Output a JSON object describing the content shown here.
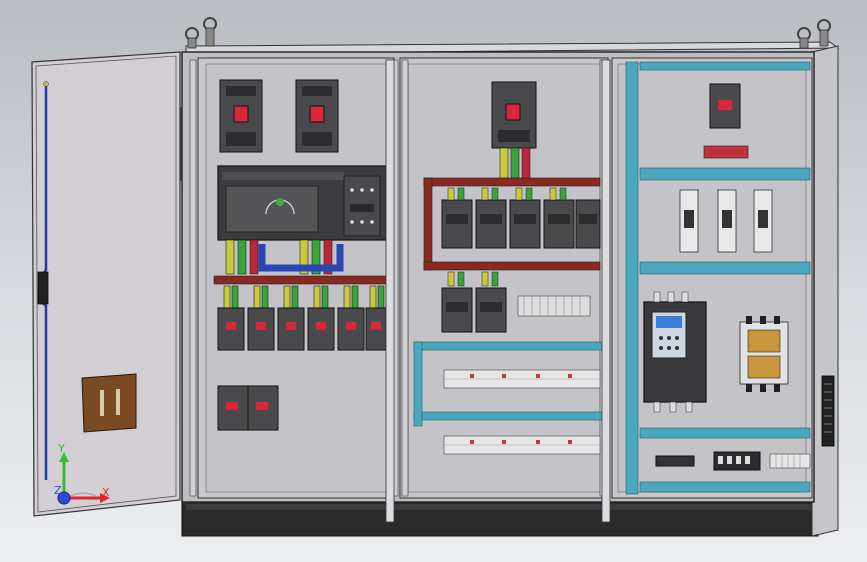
{
  "viewport": {
    "triad": {
      "x_label": "X",
      "y_label": "Y",
      "z_label": "Z"
    }
  },
  "colors": {
    "background_top": "#b9bcc1",
    "cabinet_panel": "#c8c8cc",
    "door": "#d3cdd4",
    "din_rail": "#4aa7bd",
    "busbar_red": "#8a2a22",
    "busbar_blue": "#2a46b5",
    "breaker_body": "#4a4a4c",
    "breaker_red": "#d8283c",
    "inverter_screen": "#3a7cd8",
    "contactor_orange": "#c8963c",
    "door_handle": "#7a4a22",
    "axis_x": "#e3262b",
    "axis_y": "#2fbf2f",
    "axis_z": "#2a4ad8"
  },
  "icons": [
    "electrical-cabinet-model",
    "axis-triad-icon"
  ]
}
